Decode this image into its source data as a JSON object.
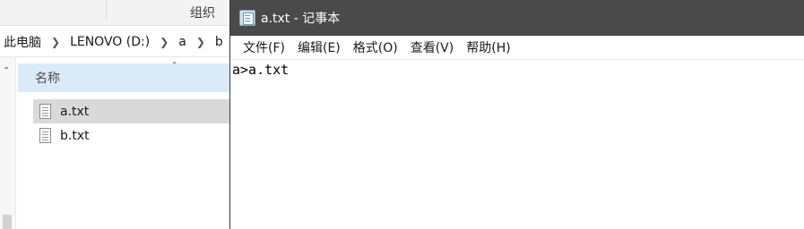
{
  "explorer": {
    "ribbon": {
      "label": "组织"
    },
    "breadcrumb": [
      "此电脑",
      "LENOVO (D:)",
      "a",
      "b"
    ],
    "columns": {
      "name": "名称"
    },
    "files": [
      {
        "name": "a.txt",
        "selected": true
      },
      {
        "name": "b.txt",
        "selected": false
      }
    ]
  },
  "notepad": {
    "title": "a.txt - 记事本",
    "menu": [
      "文件(F)",
      "编辑(E)",
      "格式(O)",
      "查看(V)",
      "帮助(H)"
    ],
    "content": "a>a.txt"
  },
  "icons": {
    "notepad_app": "notepad-icon",
    "text_file": "text-file-icon"
  },
  "colors": {
    "titlebar_bg": "#4a4a4a",
    "column_header_bg": "#d9ebf9",
    "selection_bg": "#d9d9d9"
  }
}
